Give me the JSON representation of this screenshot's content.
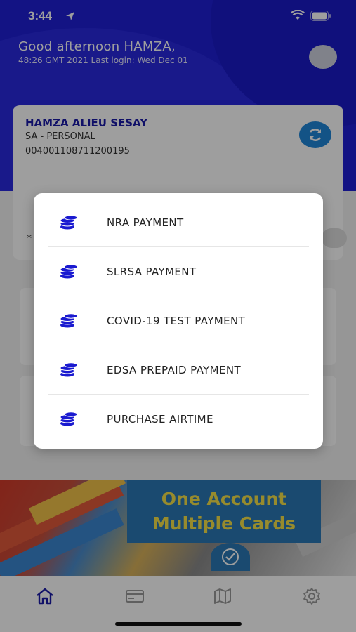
{
  "status_bar": {
    "time": "3:44"
  },
  "header": {
    "greeting": "Good afternoon HAMZA,",
    "last_login": "48:26 GMT 2021   Last login: Wed Dec 01"
  },
  "account": {
    "name": "HAMZA ALIEU SESAY",
    "type": "SA - PERSONAL",
    "number": "004001108711200195",
    "masked_prefix": "*"
  },
  "banner": {
    "line1": "One Account",
    "line2": "Multiple Cards"
  },
  "payment_menu": {
    "items": [
      {
        "label": "NRA PAYMENT",
        "icon": "coins-icon"
      },
      {
        "label": "SLRSA PAYMENT",
        "icon": "coins-icon"
      },
      {
        "label": "COVID-19 TEST PAYMENT",
        "icon": "coins-icon"
      },
      {
        "label": "EDSA PREPAID PAYMENT",
        "icon": "coins-icon"
      },
      {
        "label": "PURCHASE AIRTIME",
        "icon": "coins-icon"
      }
    ]
  },
  "bottom_nav": {
    "items": [
      {
        "icon": "home-icon",
        "active": true
      },
      {
        "icon": "card-icon",
        "active": false
      },
      {
        "icon": "map-icon",
        "active": false
      },
      {
        "icon": "gear-icon",
        "active": false
      }
    ]
  },
  "colors": {
    "brand_blue": "#1f1fd6",
    "accent_blue": "#1f86d9",
    "banner_text": "#f4e04a"
  }
}
